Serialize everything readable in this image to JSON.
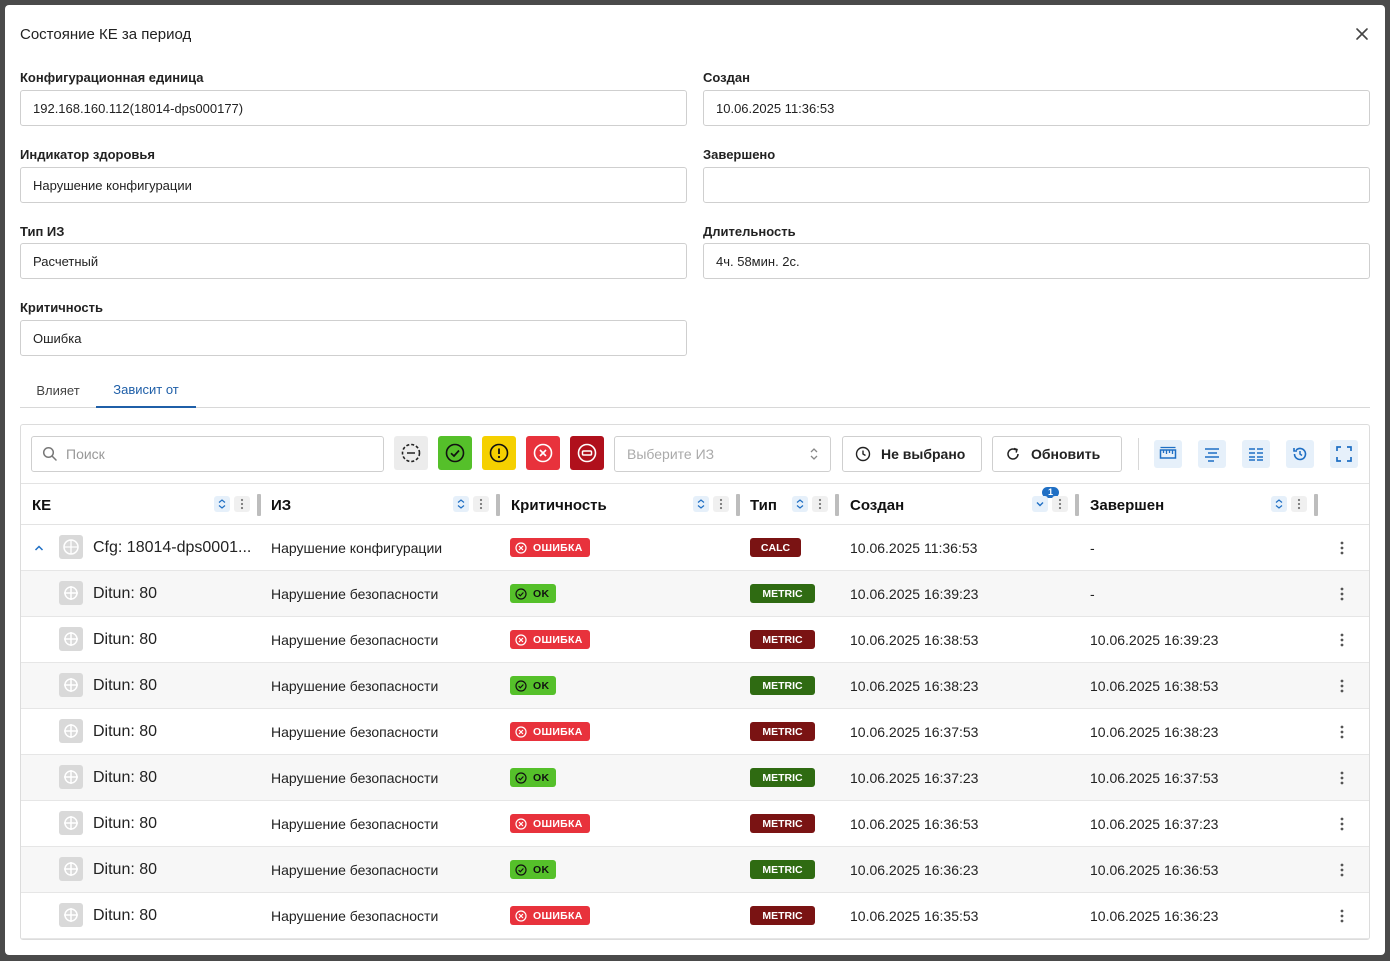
{
  "dialog": {
    "title": "Состояние КЕ за период"
  },
  "fields": {
    "ci": {
      "label": "Конфигурационная единица",
      "value": "192.168.160.112(18014-dps000177)"
    },
    "created": {
      "label": "Создан",
      "value": "10.06.2025 11:36:53"
    },
    "health": {
      "label": "Индикатор здоровья",
      "value": "Нарушение конфигурации"
    },
    "finished": {
      "label": "Завершено",
      "value": ""
    },
    "type": {
      "label": "Тип ИЗ",
      "value": "Расчетный"
    },
    "duration": {
      "label": "Длительность",
      "value": "4ч. 58мин. 2с."
    },
    "criticality": {
      "label": "Критичность",
      "value": "Ошибка"
    }
  },
  "tabs": [
    {
      "label": "Влияет",
      "active": false
    },
    {
      "label": "Зависит от",
      "active": true
    }
  ],
  "toolbar": {
    "search_placeholder": "Поиск",
    "select_placeholder": "Выберите ИЗ",
    "period_label": "Не выбрано",
    "refresh_label": "Обновить"
  },
  "colors": {
    "ok": "#55c02a",
    "warning": "#f5d000",
    "error": "#e8323c",
    "blocked": "#b0101c",
    "accent": "#1f6fc4"
  },
  "columns": {
    "ke": "КЕ",
    "hi": "ИЗ",
    "crit": "Критичность",
    "type": "Тип",
    "created": "Создан",
    "finished": "Завершен",
    "sort_count": "1"
  },
  "rows": [
    {
      "ke": "Cfg: 18014-dps0001...",
      "hi": "Нарушение конфигурации",
      "status": "ОШИБКА",
      "status_kind": "error",
      "type": "CALC",
      "type_kind": "calc",
      "created": "10.06.2025 11:36:53",
      "finished": "-",
      "parent": true
    },
    {
      "ke": "Ditun: 80",
      "hi": "Нарушение безопасности",
      "status": "OK",
      "status_kind": "ok",
      "type": "METRIC",
      "type_kind": "ok",
      "created": "10.06.2025 16:39:23",
      "finished": "-"
    },
    {
      "ke": "Ditun: 80",
      "hi": "Нарушение безопасности",
      "status": "ОШИБКА",
      "status_kind": "error",
      "type": "METRIC",
      "type_kind": "error",
      "created": "10.06.2025 16:38:53",
      "finished": "10.06.2025 16:39:23"
    },
    {
      "ke": "Ditun: 80",
      "hi": "Нарушение безопасности",
      "status": "OK",
      "status_kind": "ok",
      "type": "METRIC",
      "type_kind": "ok",
      "created": "10.06.2025 16:38:23",
      "finished": "10.06.2025 16:38:53"
    },
    {
      "ke": "Ditun: 80",
      "hi": "Нарушение безопасности",
      "status": "ОШИБКА",
      "status_kind": "error",
      "type": "METRIC",
      "type_kind": "error",
      "created": "10.06.2025 16:37:53",
      "finished": "10.06.2025 16:38:23"
    },
    {
      "ke": "Ditun: 80",
      "hi": "Нарушение безопасности",
      "status": "OK",
      "status_kind": "ok",
      "type": "METRIC",
      "type_kind": "ok",
      "created": "10.06.2025 16:37:23",
      "finished": "10.06.2025 16:37:53"
    },
    {
      "ke": "Ditun: 80",
      "hi": "Нарушение безопасности",
      "status": "ОШИБКА",
      "status_kind": "error",
      "type": "METRIC",
      "type_kind": "error",
      "created": "10.06.2025 16:36:53",
      "finished": "10.06.2025 16:37:23"
    },
    {
      "ke": "Ditun: 80",
      "hi": "Нарушение безопасности",
      "status": "OK",
      "status_kind": "ok",
      "type": "METRIC",
      "type_kind": "ok",
      "created": "10.06.2025 16:36:23",
      "finished": "10.06.2025 16:36:53"
    },
    {
      "ke": "Ditun: 80",
      "hi": "Нарушение безопасности",
      "status": "ОШИБКА",
      "status_kind": "error",
      "type": "METRIC",
      "type_kind": "error",
      "created": "10.06.2025 16:35:53",
      "finished": "10.06.2025 16:36:23"
    }
  ]
}
